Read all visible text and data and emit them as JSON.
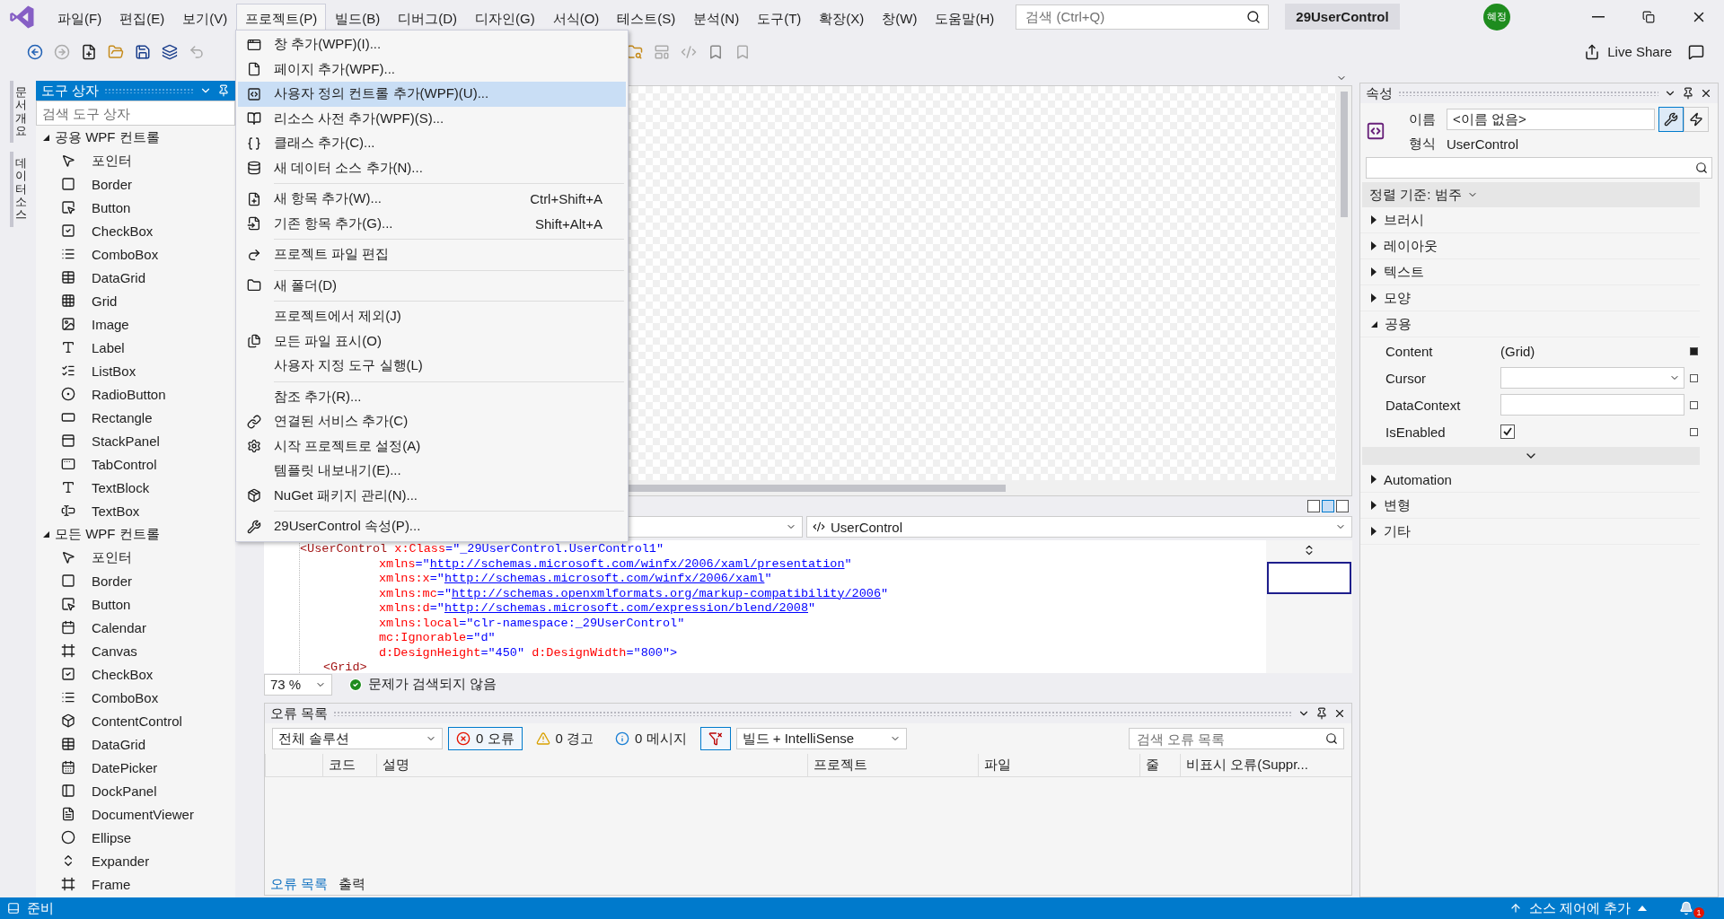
{
  "menu_bar": {
    "items": [
      {
        "label": "파일(F)",
        "selected": false
      },
      {
        "label": "편집(E)",
        "selected": false
      },
      {
        "label": "보기(V)",
        "selected": false
      },
      {
        "label": "프로젝트(P)",
        "selected": true
      },
      {
        "label": "빌드(B)",
        "selected": false
      },
      {
        "label": "디버그(D)",
        "selected": false
      },
      {
        "label": "디자인(G)",
        "selected": false
      },
      {
        "label": "서식(O)",
        "selected": false
      },
      {
        "label": "테스트(S)",
        "selected": false
      },
      {
        "label": "분석(N)",
        "selected": false
      },
      {
        "label": "도구(T)",
        "selected": false
      },
      {
        "label": "확장(X)",
        "selected": false
      },
      {
        "label": "창(W)",
        "selected": false
      },
      {
        "label": "도움말(H)",
        "selected": false
      }
    ]
  },
  "search": {
    "placeholder": "검색 (Ctrl+Q)"
  },
  "solution_name": "29UserControl",
  "user": {
    "initials": "혜정"
  },
  "live_share": "Live Share",
  "side_tabs": [
    "문서 개요",
    "데이터 소스"
  ],
  "toolbox": {
    "title": "도구 상자",
    "search_placeholder": "검색 도구 상자",
    "groups": [
      {
        "label": "공용 WPF 컨트롤",
        "expanded": true,
        "items": [
          "포인터",
          "Border",
          "Button",
          "CheckBox",
          "ComboBox",
          "DataGrid",
          "Grid",
          "Image",
          "Label",
          "ListBox",
          "RadioButton",
          "Rectangle",
          "StackPanel",
          "TabControl",
          "TextBlock",
          "TextBox"
        ]
      },
      {
        "label": "모든 WPF 컨트롤",
        "expanded": true,
        "items": [
          "포인터",
          "Border",
          "Button",
          "Calendar",
          "Canvas",
          "CheckBox",
          "ComboBox",
          "ContentControl",
          "DataGrid",
          "DatePicker",
          "DockPanel",
          "DocumentViewer",
          "Ellipse",
          "Expander",
          "Frame"
        ]
      }
    ]
  },
  "project_menu": {
    "groups": [
      [
        {
          "label": "창 추가(WPF)(I)...",
          "selected": false
        },
        {
          "label": "페이지 추가(WPF)...",
          "selected": false
        },
        {
          "label": "사용자 정의 컨트롤 추가(WPF)(U)...",
          "selected": true
        },
        {
          "label": "리소스 사전 추가(WPF)(S)...",
          "selected": false
        },
        {
          "label": "클래스 추가(C)...",
          "selected": false
        },
        {
          "label": "새 데이터 소스 추가(N)...",
          "selected": false
        }
      ],
      [
        {
          "label": "새 항목 추가(W)...",
          "shortcut": "Ctrl+Shift+A",
          "selected": false
        },
        {
          "label": "기존 항목 추가(G)...",
          "shortcut": "Shift+Alt+A",
          "selected": false
        }
      ],
      [
        {
          "label": "프로젝트 파일 편집",
          "selected": false
        }
      ],
      [
        {
          "label": "새 폴더(D)",
          "selected": false
        }
      ],
      [
        {
          "label": "프로젝트에서 제외(J)",
          "selected": false
        },
        {
          "label": "모든 파일 표시(O)",
          "selected": false
        },
        {
          "label": "사용자 지정 도구 실행(L)",
          "selected": false
        }
      ],
      [
        {
          "label": "참조 추가(R)...",
          "selected": false
        },
        {
          "label": "연결된 서비스 추가(C)",
          "selected": false
        },
        {
          "label": "시작 프로젝트로 설정(A)",
          "selected": false
        },
        {
          "label": "템플릿 내보내기(E)...",
          "selected": false
        },
        {
          "label": "NuGet 패키지 관리(N)...",
          "selected": false
        }
      ],
      [
        {
          "label": "29UserControl 속성(P)...",
          "selected": false
        }
      ]
    ]
  },
  "designer": {
    "element_combo": "UserControl",
    "code_lines": [
      {
        "kind": "start",
        "segments": [
          {
            "kind": "tag",
            "text": "<UserControl"
          },
          {
            "kind": "attr",
            "text": " x:Class"
          },
          {
            "kind": "punct",
            "text": "=\"_29UserControl.UserControl1\""
          }
        ]
      },
      {
        "kind": "continuation",
        "segments": [
          {
            "kind": "attr",
            "text": "xmlns"
          },
          {
            "kind": "punct",
            "text": "=\""
          },
          {
            "kind": "link",
            "text": "http://schemas.microsoft.com/winfx/2006/xaml/presentation"
          },
          {
            "kind": "punct",
            "text": "\""
          }
        ]
      },
      {
        "kind": "continuation",
        "segments": [
          {
            "kind": "attr",
            "text": "xmlns:x"
          },
          {
            "kind": "punct",
            "text": "=\""
          },
          {
            "kind": "link",
            "text": "http://schemas.microsoft.com/winfx/2006/xaml"
          },
          {
            "kind": "punct",
            "text": "\""
          }
        ]
      },
      {
        "kind": "continuation",
        "segments": [
          {
            "kind": "attr",
            "text": "xmlns:mc"
          },
          {
            "kind": "punct",
            "text": "=\""
          },
          {
            "kind": "link",
            "text": "http://schemas.openxmlformats.org/markup-compatibility/2006"
          },
          {
            "kind": "punct",
            "text": "\""
          }
        ]
      },
      {
        "kind": "continuation",
        "segments": [
          {
            "kind": "attr",
            "text": "xmlns:d"
          },
          {
            "kind": "punct",
            "text": "=\""
          },
          {
            "kind": "link",
            "text": "http://schemas.microsoft.com/expression/blend/2008"
          },
          {
            "kind": "punct",
            "text": "\""
          }
        ]
      },
      {
        "kind": "continuation",
        "segments": [
          {
            "kind": "attr",
            "text": "xmlns:local"
          },
          {
            "kind": "punct",
            "text": "=\"clr-namespace:_29UserControl\""
          }
        ]
      },
      {
        "kind": "continuation",
        "segments": [
          {
            "kind": "attr",
            "text": "mc:Ignorable"
          },
          {
            "kind": "punct",
            "text": "=\"d\""
          }
        ]
      },
      {
        "kind": "continuation",
        "segments": [
          {
            "kind": "attr",
            "text": "d:DesignHeight"
          },
          {
            "kind": "punct",
            "text": "=\"450\""
          },
          {
            "kind": "attr",
            "text": " d:DesignWidth"
          },
          {
            "kind": "punct",
            "text": "=\"800\">"
          }
        ]
      },
      {
        "kind": "child",
        "segments": [
          {
            "kind": "tag",
            "text": "<Grid>"
          }
        ]
      }
    ],
    "zoom": "73 %",
    "status": "문제가 검색되지 않음"
  },
  "error_list": {
    "title": "오류 목록",
    "scope": "전체 솔루션",
    "filters": [
      {
        "label": "0 오류",
        "kind": "error",
        "selected": true
      },
      {
        "label": "0 경고",
        "kind": "warning",
        "selected": false
      },
      {
        "label": "0 메시지",
        "kind": "info",
        "selected": false
      }
    ],
    "source": "빌드 + IntelliSense",
    "search_placeholder": "검색 오류 목록",
    "columns": [
      "코드",
      "설명",
      "프로젝트",
      "파일",
      "줄",
      "비표시 오류(Suppr..."
    ],
    "tabs": [
      {
        "label": "오류 목록",
        "selected": true
      },
      {
        "label": "출력",
        "selected": false
      }
    ]
  },
  "properties": {
    "title": "속성",
    "name_label": "이름",
    "name_value": "<이름 없음>",
    "type_label": "형식",
    "type_value": "UserControl",
    "sort": "정렬 기준: 범주",
    "categories": [
      {
        "label": "브러시",
        "expanded": false
      },
      {
        "label": "레이아웃",
        "expanded": false
      },
      {
        "label": "텍스트",
        "expanded": false
      },
      {
        "label": "모양",
        "expanded": false
      },
      {
        "label": "공용",
        "expanded": true,
        "rows": [
          {
            "name": "Content",
            "kind": "text",
            "value": "(Grid)",
            "set": true
          },
          {
            "name": "Cursor",
            "kind": "combo",
            "set": false
          },
          {
            "name": "DataContext",
            "kind": "field",
            "set": false
          },
          {
            "name": "IsEnabled",
            "kind": "checkbox",
            "checked": true,
            "set": false
          }
        ]
      },
      {
        "label": "Automation",
        "expanded": false
      },
      {
        "label": "변형",
        "expanded": false
      },
      {
        "label": "기타",
        "expanded": false
      }
    ]
  },
  "status_bar": {
    "left": "준비",
    "right": "소스 제어에 추가",
    "notifications": "1"
  }
}
